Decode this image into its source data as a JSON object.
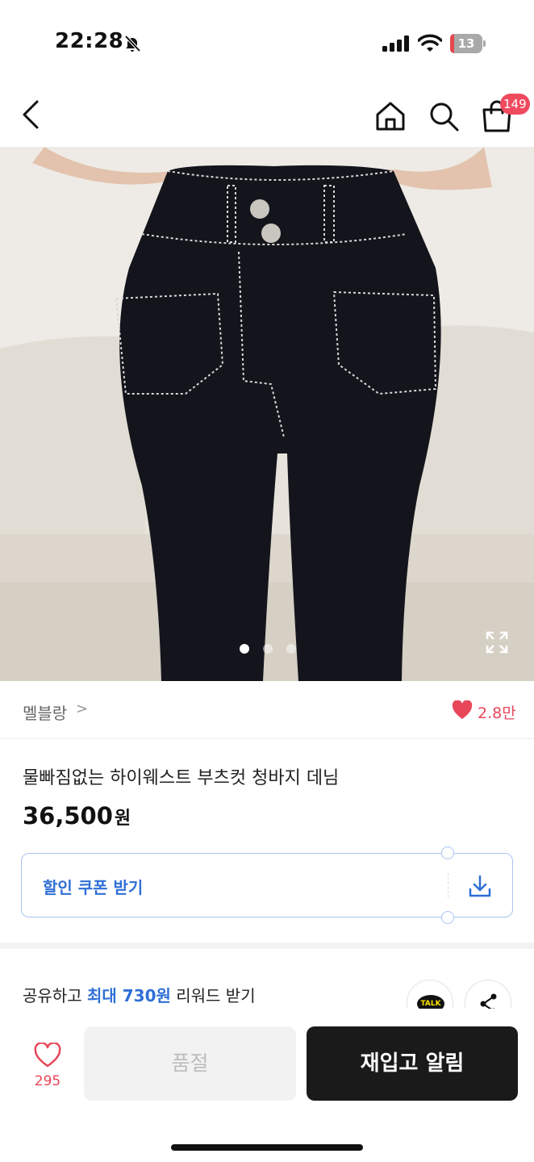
{
  "status_bar": {
    "time": "22:28",
    "battery": "13",
    "battery_level_percent": 13,
    "icons": [
      "bell-off-icon",
      "cellular-signal-icon",
      "wifi-icon",
      "battery-icon"
    ]
  },
  "nav": {
    "icons": [
      "back-chevron-icon",
      "home-icon",
      "search-icon",
      "shopping-bag-icon"
    ],
    "cart_badge": "149"
  },
  "gallery": {
    "image_count": 3,
    "active_index": 0,
    "expand_icon": "expand-icon"
  },
  "brand": {
    "name": "멜블랑",
    "chevron": ">",
    "like_count": "2.8만"
  },
  "product": {
    "title": "물빠짐없는 하이웨스트 부츠컷 청바지 데님",
    "price": "36,500",
    "price_unit": "원"
  },
  "coupon": {
    "label": "할인 쿠폰 받기",
    "icon": "download-icon"
  },
  "share": {
    "prefix": "공유하고 ",
    "highlight": "최대 730원",
    "suffix": " 리워드 받기",
    "talk_label": "TALK",
    "share_icon": "share-icon"
  },
  "bottom_bar": {
    "wish_count": "295",
    "soldout_label": "품절",
    "restock_label": "재입고 알림"
  },
  "colors": {
    "accent_blue": "#2f6fd6",
    "like_red": "#e8475a",
    "badge_red": "#f04a5e",
    "cta_dark": "#1a1a1a"
  }
}
